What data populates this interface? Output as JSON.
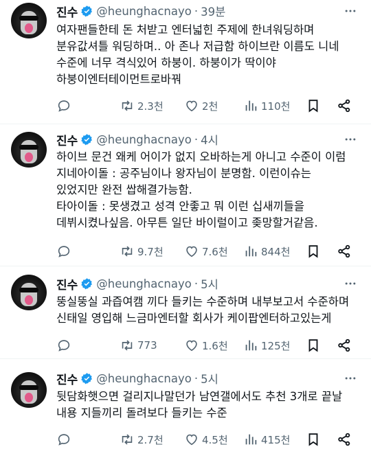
{
  "tweets": [
    {
      "name": "진수",
      "handle": "@heunghacnayo",
      "time": "39분",
      "text": "여자팬들한테 돈 처받고 엔터넓힌 주제에 한녀워딩하며\n분유값셔틀 워딩하며.. 아 존나 저급함 하이브란 이름도 니네\n수준에 너무 격식있어 하붕이. 하붕이가 딱이야\n하붕이엔터테이먼트로바꿔",
      "retweets": "2.3천",
      "likes": "2천",
      "views": "110천"
    },
    {
      "name": "진수",
      "handle": "@heunghacnayo",
      "time": "4시",
      "text": "하이브 문건 왜케 어이가 없지 오바하는게 아니고 수준이 이럼\n지네아이돌 : 공주님이나 왕자님이 분명함. 이런이슈는\n있었지만 완전 쌉해결가능함.\n타아이돌 : 못생겼고 성격 안좋고 뭐 이런 십새끼들을\n데뷔시켰나싶음. 아무튼 일단 바이럴이고 좆망할거같음.",
      "retweets": "9.7천",
      "likes": "7.6천",
      "views": "844천"
    },
    {
      "name": "진수",
      "handle": "@heunghacnayo",
      "time": "5시",
      "text": "뚱실뚱실 과즙여캠 끼다 들키는 수준하며 내부보고서 수준하며\n신태일 영입해 느금마엔터할 회사가 케이팝엔터하고있는게",
      "retweets": "773",
      "likes": "1.6천",
      "views": "125천"
    },
    {
      "name": "진수",
      "handle": "@heunghacnayo",
      "time": "5시",
      "text": "뒷담화햇으면 걸리지나말던가 남연갤에서도 추천 3개로 끝날\n내용 지들끼리 돌려보다 들키는 수준",
      "retweets": "2.7천",
      "likes": "4.5천",
      "views": "415천"
    }
  ],
  "icons": {
    "verified": "verified-badge-icon",
    "more": "more-icon",
    "reply": "reply-icon",
    "retweet": "retweet-icon",
    "like": "heart-icon",
    "views": "views-chart-icon",
    "bookmark": "bookmark-icon",
    "share": "share-icon"
  },
  "colors": {
    "verified": "#1d9bf0",
    "text": "#0f1419",
    "secondary": "#536471",
    "divider": "#eff3f4"
  }
}
